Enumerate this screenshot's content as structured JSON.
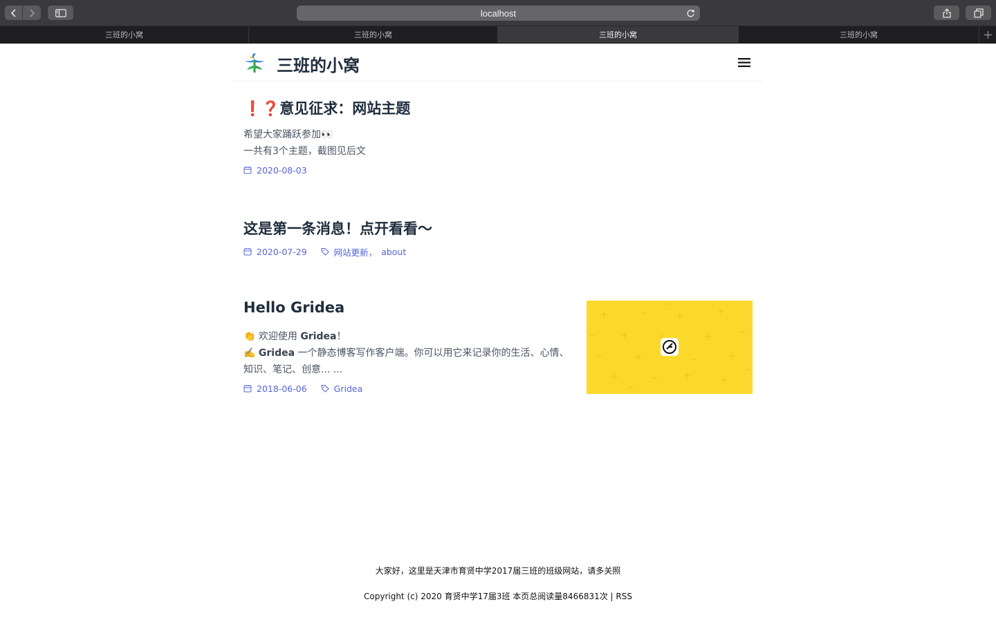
{
  "browser": {
    "address": "localhost",
    "tabs": [
      {
        "label": "三班的小窝",
        "active": false
      },
      {
        "label": "三班的小窝",
        "active": false
      },
      {
        "label": "三班的小窝",
        "active": true
      },
      {
        "label": "三班的小窝",
        "active": false
      }
    ]
  },
  "site": {
    "title": "三班的小窝",
    "accent_color": "#5463d8"
  },
  "posts": [
    {
      "title_emoji": "❗❓",
      "title": "意见征求：网站主题",
      "abstract_line1": "希望大家踊跃参加👀",
      "abstract_line2": "一共有3个主题，截图见后文",
      "date": "2020-08-03"
    },
    {
      "title": "这是第一条消息！点开看看～",
      "date": "2020-07-29",
      "tags": [
        "网站更新",
        "about"
      ],
      "tag_separator": "，"
    },
    {
      "title": "Hello Gridea",
      "abstract_line1_prefix": "👏 欢迎使用 ",
      "abstract_line1_bold": "Gridea",
      "abstract_line1_suffix": "！",
      "abstract_line2_prefix": "✍️ ",
      "abstract_line2_bold": "Gridea",
      "abstract_line2_suffix": " 一个静态博客写作客户端。你可以用它来记录你的生活、心情、",
      "abstract_line3": "知识、笔记、创意... ...",
      "date": "2018-06-06",
      "tags": [
        "Gridea"
      ],
      "feature_bg_color": "#fbd92c"
    }
  ],
  "footer": {
    "line1": "大家好，这里是天津市育贤中学2017届三班的班级网站，请多关照",
    "line2_text": "Copyright (c) 2020 育贤中学17届3班 本页总阅读量8466831次 | ",
    "rss_label": "RSS"
  }
}
